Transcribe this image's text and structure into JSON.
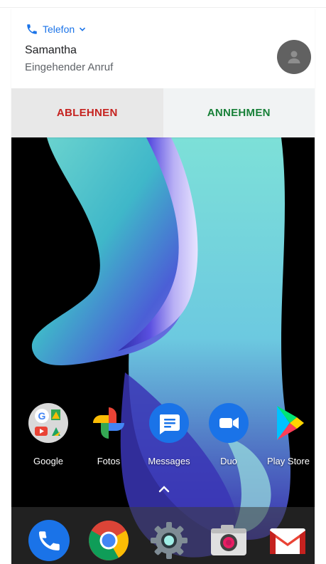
{
  "notification": {
    "app_name": "Telefon",
    "caller_name": "Samantha",
    "call_status": "Eingehender Anruf",
    "decline_label": "ABLEHNEN",
    "accept_label": "ANNEHMEN",
    "colors": {
      "app_accent": "#1a73e8",
      "decline": "#c5221f",
      "accept": "#188038",
      "avatar_bg": "#616161"
    }
  },
  "home": {
    "apps": [
      {
        "label": "Google",
        "icon": "google-folder-icon"
      },
      {
        "label": "Fotos",
        "icon": "photos-pinwheel-icon"
      },
      {
        "label": "Messages",
        "icon": "messages-bubble-icon"
      },
      {
        "label": "Duo",
        "icon": "duo-video-icon"
      },
      {
        "label": "Play Store",
        "icon": "play-store-triangle-icon"
      }
    ],
    "dock": [
      {
        "icon": "phone-icon"
      },
      {
        "icon": "chrome-icon"
      },
      {
        "icon": "settings-gear-icon"
      },
      {
        "icon": "camera-icon"
      },
      {
        "icon": "gmail-icon"
      }
    ]
  }
}
